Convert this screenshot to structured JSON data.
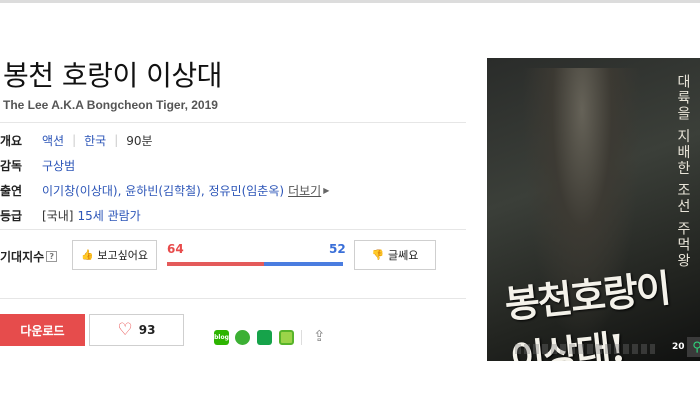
{
  "movie": {
    "title": "봉천 호랑이 이상대",
    "subtitle": "The Lee A.K.A Bongcheon Tiger, 2019"
  },
  "info": {
    "overview": {
      "label": "개요",
      "genre": "액션",
      "country": "한국",
      "runtime": "90분"
    },
    "director": {
      "label": "감독",
      "name": "구상범"
    },
    "cast": {
      "label": "출연",
      "text": "이기창(이상대), 윤하빈(김학철), 정유민(임춘옥)",
      "more": "더보기"
    },
    "rating": {
      "label": "등급",
      "prefix": "[국내]",
      "value": "15세 관람가"
    }
  },
  "expect": {
    "label": "기대지수",
    "help": "?",
    "want_label": "보고싶어요",
    "nowant_label": "글쎄요",
    "want_count": "64",
    "nowant_count": "52",
    "want_ratio": 0.552
  },
  "actions": {
    "download_label": "다운로드",
    "like_count": "93"
  },
  "share": {
    "naver_label": "blog"
  },
  "poster": {
    "tagline": "대륙을 지배한 조선 주먹왕",
    "title": "봉천호랑이 이상대!",
    "age": "20"
  },
  "colors": {
    "accent": "#e64c4c",
    "link": "#2d56b8",
    "nowant": "#4a7de0"
  }
}
